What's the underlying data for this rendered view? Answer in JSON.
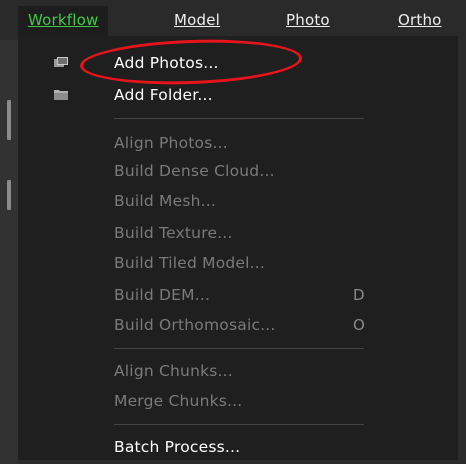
{
  "menubar": {
    "items": [
      {
        "label": "Workflow",
        "active": true
      },
      {
        "label": "Model"
      },
      {
        "label": "Photo"
      },
      {
        "label": "Ortho"
      }
    ]
  },
  "menu": {
    "add_photos": {
      "label": "Add Photos...",
      "icon": "add-photos-icon"
    },
    "add_folder": {
      "label": "Add Folder...",
      "icon": "add-folder-icon"
    },
    "align_photos": {
      "label": "Align Photos..."
    },
    "build_dense_cloud": {
      "label": "Build Dense Cloud..."
    },
    "build_mesh": {
      "label": "Build Mesh..."
    },
    "build_texture": {
      "label": "Build Texture..."
    },
    "build_tiled_model": {
      "label": "Build Tiled Model..."
    },
    "build_dem": {
      "label": "Build DEM...",
      "shortcut": "D"
    },
    "build_orthomosaic": {
      "label": "Build Orthomosaic...",
      "shortcut": "O"
    },
    "align_chunks": {
      "label": "Align Chunks..."
    },
    "merge_chunks": {
      "label": "Merge Chunks..."
    },
    "batch_process": {
      "label": "Batch Process..."
    }
  },
  "colors": {
    "active_menu_text": "#3fc84a",
    "annotation": "#e8141b"
  }
}
